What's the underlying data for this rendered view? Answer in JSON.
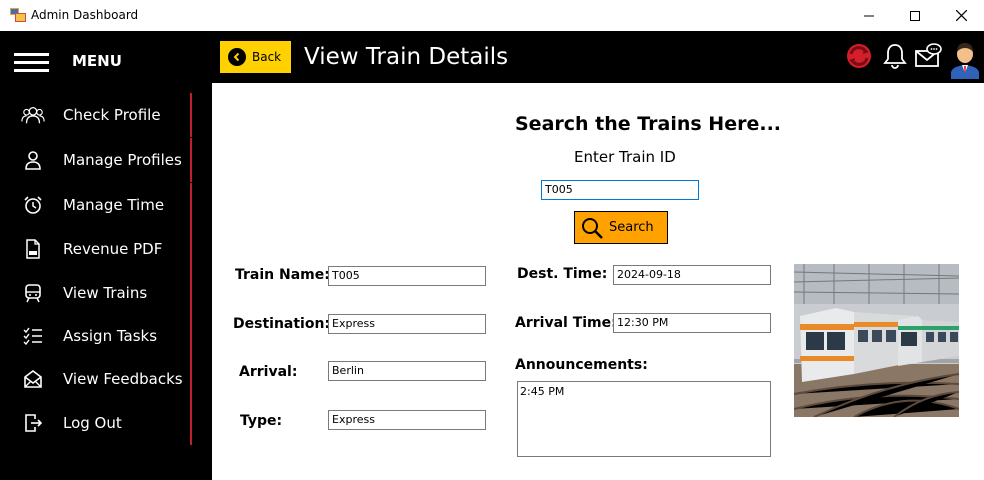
{
  "window": {
    "title": "Admin Dashboard"
  },
  "header": {
    "menu_label": "MENU",
    "back_label": "Back",
    "page_title": "View Train Details"
  },
  "sidebar": {
    "items": [
      {
        "label": "Check Profile",
        "icon": "users-icon"
      },
      {
        "label": "Manage Profiles",
        "icon": "user-icon"
      },
      {
        "label": "Manage Time",
        "icon": "alarm-clock-icon"
      },
      {
        "label": "Revenue PDF",
        "icon": "pdf-file-icon"
      },
      {
        "label": "View Trains",
        "icon": "train-icon"
      },
      {
        "label": "Assign Tasks",
        "icon": "task-list-icon"
      },
      {
        "label": "View Feedbacks",
        "icon": "feedback-envelope-icon"
      },
      {
        "label": "Log Out",
        "icon": "logout-icon"
      }
    ]
  },
  "search": {
    "heading": "Search the Trains Here...",
    "prompt": "Enter Train ID",
    "train_id_value": "T005",
    "button_label": "Search"
  },
  "details": {
    "train_name_label": "Train Name:",
    "train_name_value": "T005",
    "destination_label": "Destination:",
    "destination_value": "Express",
    "arrival_label": "Arrival:",
    "arrival_value": "Berlin",
    "type_label": "Type:",
    "type_value": "Express",
    "dest_time_label": "Dest. Time:",
    "dest_time_value": "2024-09-18",
    "arrival_time_label": "Arrival Time:",
    "arrival_time_value": "12:30 PM",
    "announcements_label": "Announcements:",
    "announcements_value": "2:45 PM"
  },
  "colors": {
    "accent_yellow": "#ffd100",
    "search_orange": "#ffa200",
    "sidebar_bar": "#c0202a"
  }
}
